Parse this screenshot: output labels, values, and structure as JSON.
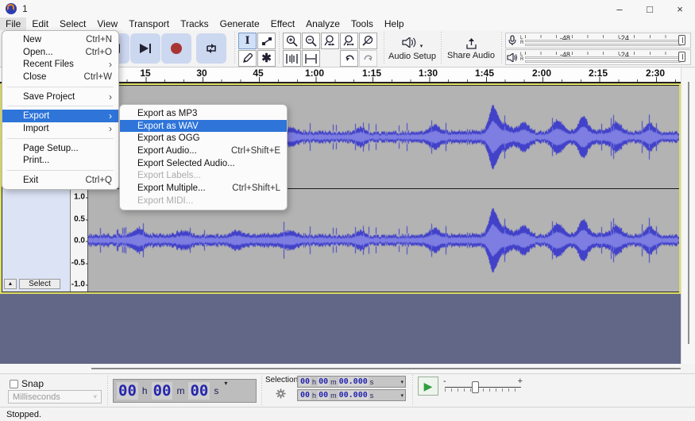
{
  "window": {
    "title": "1",
    "minimize": "–",
    "maximize": "□",
    "close": "×"
  },
  "menubar": {
    "items": [
      "File",
      "Edit",
      "Select",
      "View",
      "Transport",
      "Tracks",
      "Generate",
      "Effect",
      "Analyze",
      "Tools",
      "Help"
    ],
    "active": "File"
  },
  "file_menu": {
    "items": [
      {
        "label": "New",
        "shortcut": "Ctrl+N"
      },
      {
        "label": "Open...",
        "shortcut": "Ctrl+O"
      },
      {
        "label": "Recent Files",
        "arrow": "›"
      },
      {
        "label": "Close",
        "shortcut": "Ctrl+W"
      },
      {
        "label": "Save Project",
        "arrow": "›"
      },
      {
        "label": "Export",
        "arrow": "›",
        "highlighted": true
      },
      {
        "label": "Import",
        "arrow": "›"
      },
      {
        "label": "Page Setup..."
      },
      {
        "label": "Print..."
      },
      {
        "label": "Exit",
        "shortcut": "Ctrl+Q"
      }
    ]
  },
  "export_submenu": {
    "items": [
      {
        "label": "Export as MP3"
      },
      {
        "label": "Export as WAV",
        "highlighted": true
      },
      {
        "label": "Export as OGG"
      },
      {
        "label": "Export Audio...",
        "shortcut": "Ctrl+Shift+E"
      },
      {
        "label": "Export Selected Audio..."
      },
      {
        "label": "Export Labels...",
        "disabled": true
      },
      {
        "label": "Export Multiple...",
        "shortcut": "Ctrl+Shift+L"
      },
      {
        "label": "Export MIDI...",
        "disabled": true
      }
    ]
  },
  "toolbar": {
    "audio_setup_label": "Audio Setup",
    "share_audio_label": "Share Audio",
    "meters": {
      "channel_labels": "LR",
      "db_ticks": [
        "-48",
        "-24"
      ]
    }
  },
  "timeline": {
    "labels": [
      "15",
      "30",
      "45",
      "1:00",
      "1:15",
      "1:30",
      "1:45",
      "2:00",
      "2:15",
      "2:30"
    ]
  },
  "track": {
    "scale": [
      "1.0",
      "0.5",
      "0.0",
      "-0.5",
      "-1.0"
    ],
    "select_label": "Select",
    "collapse_glyph": "▲",
    "channels": 2
  },
  "bottom": {
    "snap_label": "Snap",
    "snap_mode": "Milliseconds",
    "time_display": {
      "h": "00",
      "hu": "h",
      "m": "00",
      "mu": "m",
      "s": "00",
      "su": "s"
    },
    "selection_label": "Selection",
    "selection_start": {
      "h": "00",
      "hu": "h",
      "m": "00",
      "mu": "m",
      "s": "00.000",
      "su": "s"
    },
    "selection_end": {
      "h": "00",
      "hu": "h",
      "m": "00",
      "mu": "m",
      "s": "00.000",
      "su": "s"
    },
    "speed_minus": "-",
    "speed_plus": "+"
  },
  "status_bar": {
    "text": "Stopped."
  },
  "colors": {
    "menu_highlight": "#2e74d9",
    "canvas_background": "#636787",
    "track_background": "#b3b3b3",
    "waveform": "#4141c9",
    "waveform_inner": "#7d7de2",
    "transport_button": "#ccd7f0",
    "record_red": "#a93434",
    "play_green": "#2f9e3f",
    "focus_border_yellow": "#dede66",
    "panel_blue": "#dbe3f5"
  }
}
